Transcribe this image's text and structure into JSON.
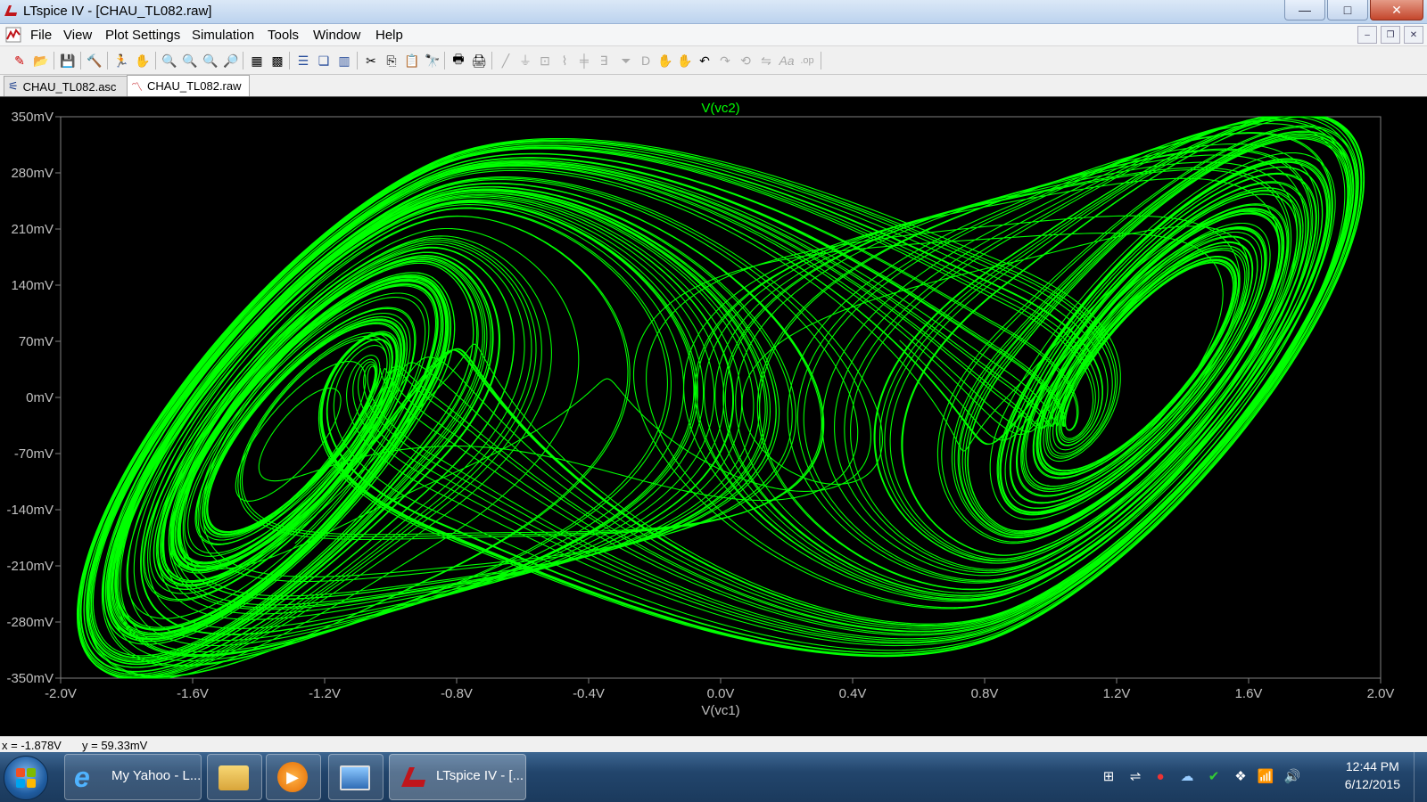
{
  "window": {
    "title": "LTspice IV - [CHAU_TL082.raw]",
    "minimize": "—",
    "maximize": "□",
    "close": "✕"
  },
  "menu": {
    "file": "File",
    "view": "View",
    "plot_settings": "Plot Settings",
    "simulation": "Simulation",
    "tools": "Tools",
    "window": "Window",
    "help": "Help"
  },
  "tabs": [
    {
      "label": "CHAU_TL082.asc",
      "active": false
    },
    {
      "label": "CHAU_TL082.raw",
      "active": true
    }
  ],
  "toolbar_icons": [
    "new-schematic-icon",
    "open-icon",
    "save-icon",
    "control-panel-icon",
    "run-icon",
    "halt-icon",
    "zoom-in-icon",
    "zoom-out-icon",
    "zoom-full-icon",
    "cancel-zoom-icon",
    "autorange-icon",
    "zoom-box-icon",
    "tile-horizontal-icon",
    "cascade-icon",
    "tile-vertical-icon",
    "cut-icon",
    "copy-icon",
    "paste-icon",
    "find-icon",
    "print-preview-icon",
    "print-icon",
    "wire-icon",
    "ground-icon",
    "label-icon",
    "resistor-icon",
    "capacitor-icon",
    "inductor-icon",
    "diode-icon",
    "component-icon",
    "move-icon",
    "drag-icon",
    "undo-icon",
    "redo-icon",
    "rotate-icon",
    "mirror-icon",
    "text-icon",
    "spice-directive-icon"
  ],
  "chart_data": {
    "type": "line",
    "title": "V(vc2)",
    "xlabel": "V(vc1)",
    "ylabel": "",
    "xlim": [
      -2.0,
      2.0
    ],
    "ylim": [
      -350,
      350
    ],
    "x_ticks": [
      "-2.0V",
      "-1.6V",
      "-1.2V",
      "-0.8V",
      "-0.4V",
      "0.0V",
      "0.4V",
      "0.8V",
      "1.2V",
      "1.6V",
      "2.0V"
    ],
    "x_tick_values": [
      -2.0,
      -1.6,
      -1.2,
      -0.8,
      -0.4,
      0.0,
      0.4,
      0.8,
      1.2,
      1.6,
      2.0
    ],
    "y_ticks": [
      "350mV",
      "280mV",
      "210mV",
      "140mV",
      "70mV",
      "0mV",
      "-70mV",
      "-140mV",
      "-210mV",
      "-280mV",
      "-350mV"
    ],
    "y_tick_values": [
      350,
      280,
      210,
      140,
      70,
      0,
      -70,
      -140,
      -210,
      -280,
      -350
    ],
    "trace_color": "#00ff00",
    "background": "#000000",
    "series": [
      {
        "name": "V(vc2)",
        "description_shape": "double-scroll attractor",
        "x_range": [
          -1.95,
          1.95
        ],
        "y_range": [
          -345,
          345
        ],
        "x_units": "V",
        "y_units": "mV"
      }
    ]
  },
  "status": {
    "x": "x = -1.878V",
    "y": "y = 59.33mV"
  },
  "taskbar": {
    "items": [
      {
        "label": "My Yahoo - L...",
        "icon": "internet-explorer-icon"
      },
      {
        "label": "",
        "icon": "file-explorer-icon"
      },
      {
        "label": "",
        "icon": "media-player-icon"
      },
      {
        "label": "",
        "icon": "remote-desktop-icon"
      },
      {
        "label": "LTspice IV - [...",
        "icon": "ltspice-icon"
      }
    ],
    "time": "12:44 PM",
    "date": "6/12/2015"
  }
}
